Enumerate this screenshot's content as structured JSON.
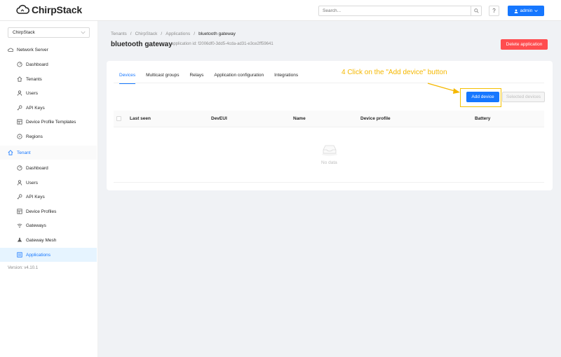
{
  "brand": {
    "name": "ChirpStack"
  },
  "header": {
    "search_placeholder": "Search...",
    "help_label": "?",
    "user_label": "admin"
  },
  "sidebar": {
    "tenant_selected": "ChirpStack",
    "network_server_label": "Network Server",
    "network_items": [
      {
        "label": "Dashboard",
        "icon": "dashboard-icon"
      },
      {
        "label": "Tenants",
        "icon": "home-icon"
      },
      {
        "label": "Users",
        "icon": "user-icon"
      },
      {
        "label": "API Keys",
        "icon": "key-icon"
      },
      {
        "label": "Device Profile Templates",
        "icon": "template-icon"
      },
      {
        "label": "Regions",
        "icon": "compass-icon"
      }
    ],
    "tenant_label": "Tenant",
    "tenant_items": [
      {
        "label": "Dashboard",
        "icon": "dashboard-icon"
      },
      {
        "label": "Users",
        "icon": "user-icon"
      },
      {
        "label": "API Keys",
        "icon": "key-icon"
      },
      {
        "label": "Device Profiles",
        "icon": "template-icon"
      },
      {
        "label": "Gateways",
        "icon": "wifi-icon"
      },
      {
        "label": "Gateway Mesh",
        "icon": "mesh-icon"
      },
      {
        "label": "Applications",
        "icon": "apps-icon"
      }
    ],
    "version": "Version: v4.10.1"
  },
  "breadcrumb": [
    "Tenants",
    "ChirpStack",
    "Applications",
    "bluetooth gateway"
  ],
  "page": {
    "title": "bluetooth gateway",
    "app_id": "application id: f2006df0-3dd5-4cda-ad31-e3ce2ff59641",
    "delete_label": "Delete application"
  },
  "tabs": [
    "Devices",
    "Multicast groups",
    "Relays",
    "Application configuration",
    "Integrations"
  ],
  "actions": {
    "add_device": "Add device",
    "selected_devices": "Selected devices"
  },
  "annotation": {
    "text": "4 Click on the \"Add device\" button"
  },
  "table": {
    "columns": [
      "Last seen",
      "DevEUI",
      "Name",
      "Device profile",
      "Battery"
    ],
    "empty_text": "No data"
  },
  "colors": {
    "primary": "#1677ff",
    "danger": "#ff4d4f",
    "annotation": "#f5b800"
  }
}
